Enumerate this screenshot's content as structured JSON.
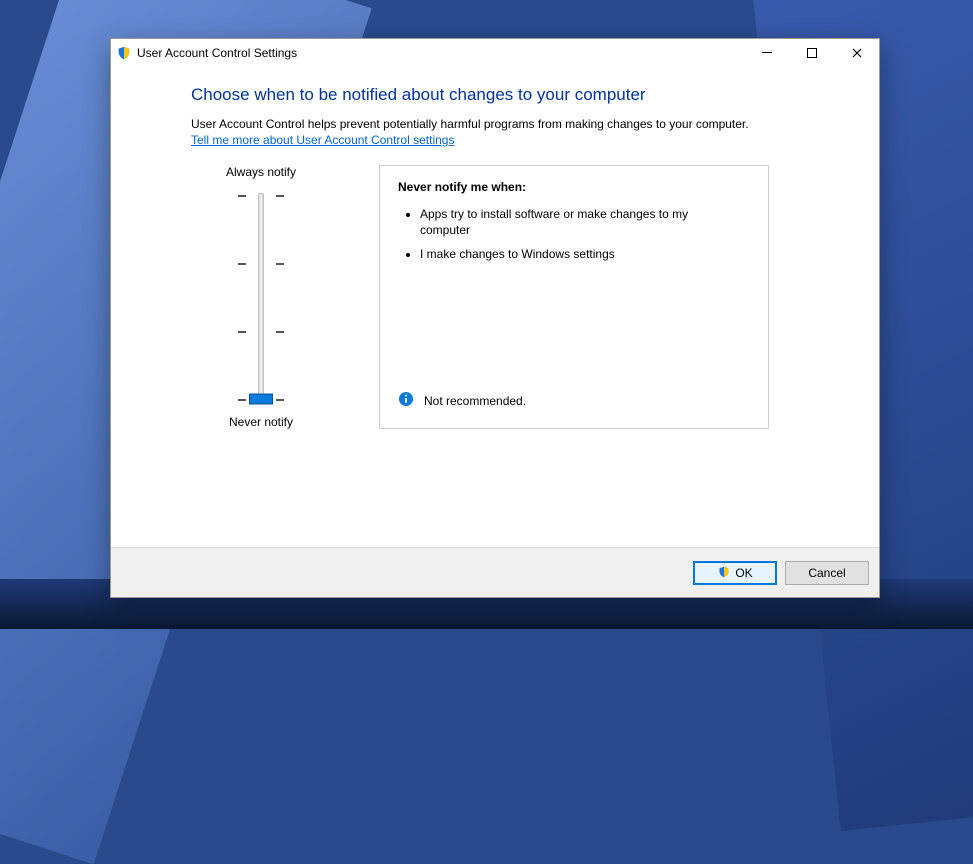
{
  "window": {
    "title": "User Account Control Settings"
  },
  "heading": "Choose when to be notified about changes to your computer",
  "description": "User Account Control helps prevent potentially harmful programs from making changes to your computer.",
  "help_link": "Tell me more about User Account Control settings",
  "slider": {
    "top_label": "Always notify",
    "bottom_label": "Never notify",
    "levels": 4,
    "current_level": 0
  },
  "info": {
    "heading": "Never notify me when:",
    "bullets": [
      "Apps try to install software or make changes to my computer",
      "I make changes to Windows settings"
    ],
    "status_text": "Not recommended."
  },
  "buttons": {
    "ok": "OK",
    "cancel": "Cancel"
  }
}
